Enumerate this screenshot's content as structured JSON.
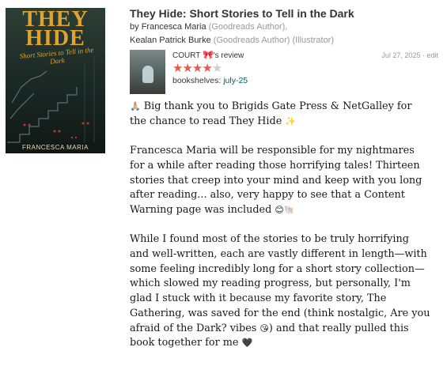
{
  "book": {
    "title": "They Hide: Short Stories to Tell in the Dark",
    "by": "by",
    "author1": "Francesca Maria",
    "author1_role": "(Goodreads Author),",
    "author2": "Kealan Patrick Burke",
    "author2_role": "(Goodreads Author) (Illustrator)"
  },
  "cover": {
    "title_line1": "THEY",
    "title_line2": "HIDE",
    "subtitle": "Short Stories to Tell in the Dark",
    "author": "FRANCESCA MARIA",
    "colors": {
      "background": "#1d2b27",
      "title": "#e0a32d"
    }
  },
  "review": {
    "reviewer": "COURT",
    "reviewer_emoji": "🎀",
    "review_suffix": "'s review",
    "date": "Jul 27, 2025",
    "separator": "·",
    "edit_label": "edit",
    "rating": 4,
    "rating_max": 5,
    "shelves_label": "bookshelves:",
    "shelf": "july-25",
    "paragraphs": [
      {
        "lead_emoji": "🙏🏼",
        "text": "Big thank you to Brigids Gate Press & NetGalley for the chance to read They Hide",
        "trail_emoji": "✨"
      },
      {
        "lead_emoji": "",
        "text": "Francesca Maria will be responsible for my nightmares for a while after reading those horrifying tales! Thirteen stories that creep into your mind and keep with you long after reading... also, very happy to see that a Content Warning page was included",
        "trail_emoji": "😊🐚"
      },
      {
        "lead_emoji": "",
        "text": "While I found most of the stories to be truly horrifying and well-written, each are vastly different in length—with some feeling incredibly long for a short story collection—which slowed my reading progress, but personally, I'm glad I stuck with it because my favorite story, The Gathering, was saved for the end (think nostalgic, Are you afraid of the Dark? vibes",
        "trail_emoji": "😘",
        "text_after": ") and that really pulled this book together for me",
        "end_emoji": "🖤"
      }
    ]
  },
  "colors": {
    "star_on": "#e55b4b",
    "star_off": "#cccccc",
    "link": "#00635d",
    "muted": "#999999"
  }
}
